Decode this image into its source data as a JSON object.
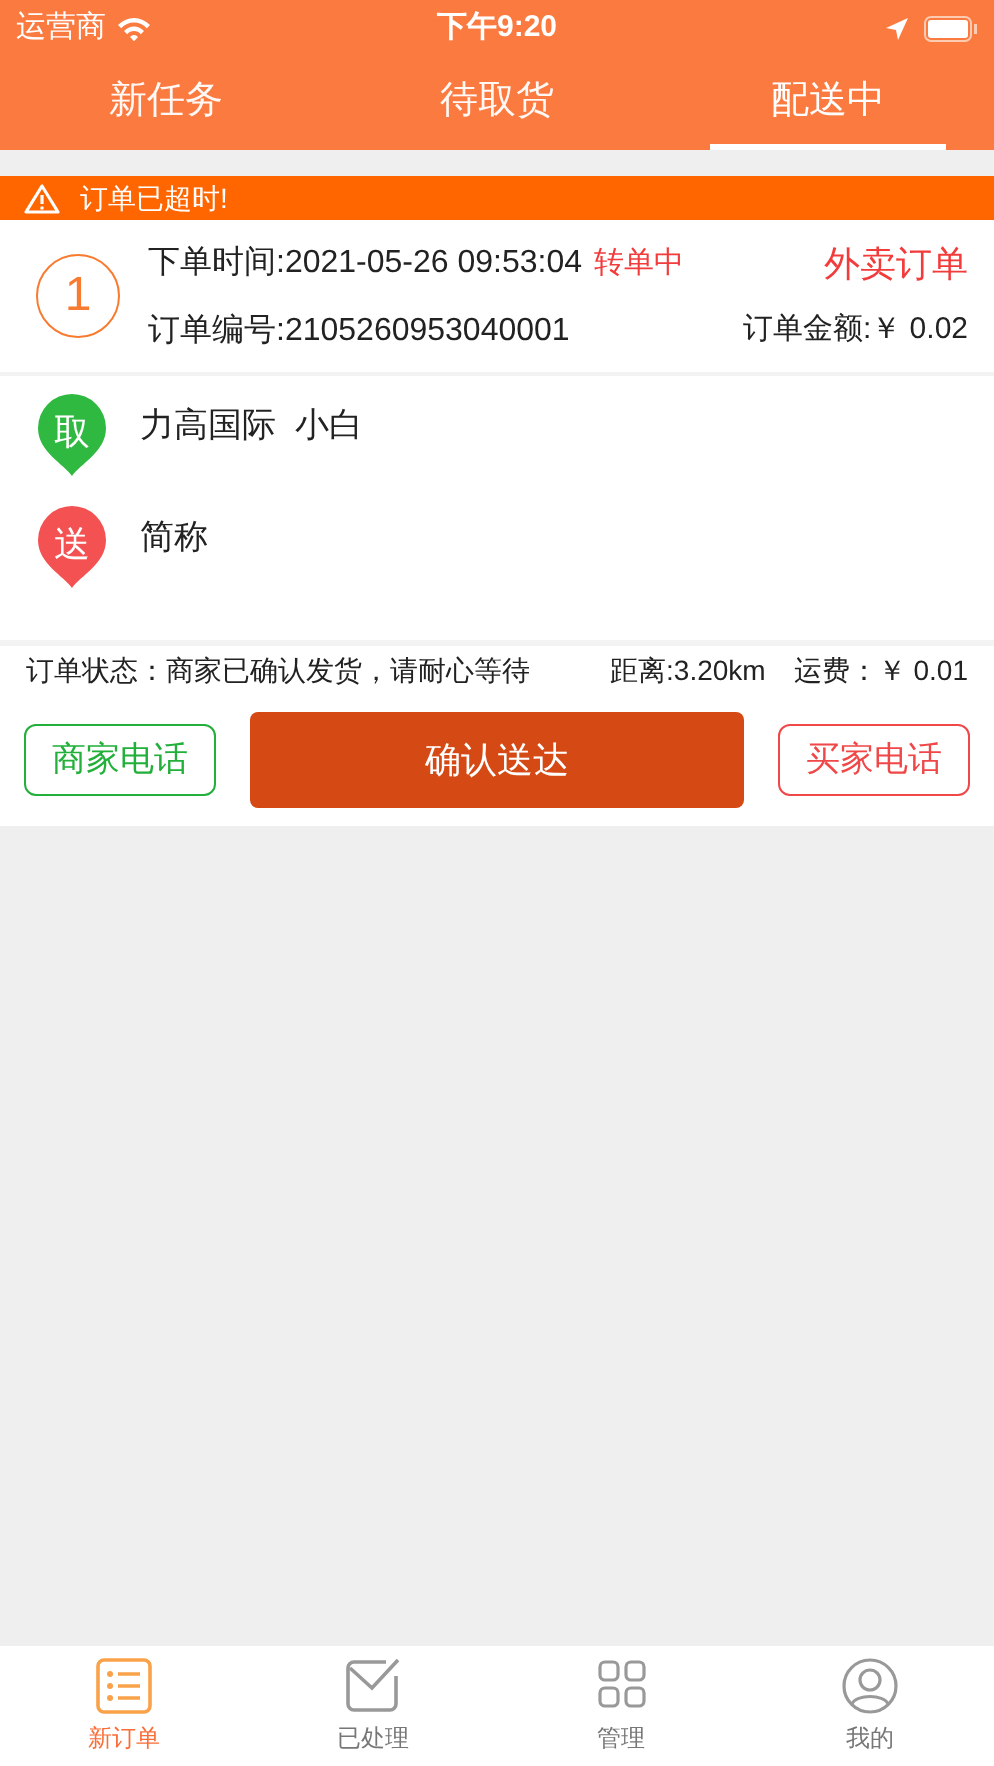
{
  "status_bar": {
    "carrier": "运营商",
    "time": "下午9:20"
  },
  "tabs": [
    {
      "label": "新任务",
      "selected": false
    },
    {
      "label": "待取货",
      "selected": false
    },
    {
      "label": "配送中",
      "selected": true
    }
  ],
  "alert": {
    "text": "订单已超时!"
  },
  "order": {
    "index": "1",
    "order_time": "下单时间:2021-05-26 09:53:04",
    "transfer_status": "转单中",
    "order_type": "外卖订单",
    "order_number": "订单编号:2105260953040001",
    "amount": "订单金额:￥ 0.02",
    "addresses": [
      {
        "badge": "取",
        "name": "力高国际  小白",
        "color": "#2fb940"
      },
      {
        "badge": "送",
        "name": "简称",
        "color": "#f45252"
      }
    ],
    "status": "订单状态：商家已确认发货，请耐心等待",
    "distance": "距离:3.20km",
    "fee": "运费：￥ 0.01",
    "buttons": [
      {
        "label": "商家电话",
        "kind": "outline",
        "color": "#22b03a"
      },
      {
        "label": "确认送达",
        "kind": "solid",
        "color": "#d44914"
      },
      {
        "label": "买家电话",
        "kind": "outline",
        "color": "#f04848"
      }
    ]
  },
  "bottom_nav": [
    {
      "label": "新订单",
      "kind": "list",
      "selected": true
    },
    {
      "label": "已处理",
      "kind": "done",
      "selected": false
    },
    {
      "label": "管理",
      "kind": "grid",
      "selected": false
    },
    {
      "label": "我的",
      "kind": "profile",
      "selected": false
    }
  ]
}
